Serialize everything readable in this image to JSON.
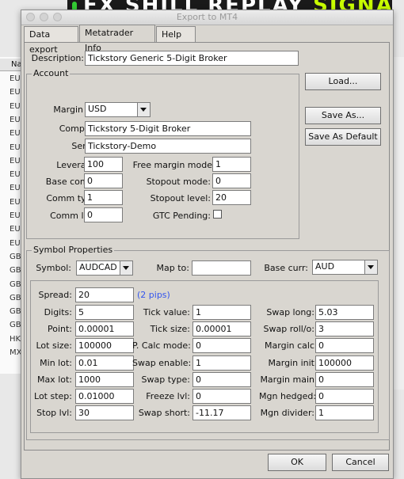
{
  "background": {
    "banner_text": "FX SHILL REPLAY ",
    "banner_highlight": "SIGNALS",
    "list_header": "Na",
    "list_rows": [
      "EU",
      "EU",
      "EU",
      "EU",
      "EU",
      "EU",
      "EU",
      "EU",
      "EU",
      "EU",
      "EU",
      "EU",
      "EU",
      "GB",
      "GB",
      "GB",
      "GB",
      "GB",
      "GB",
      "HK",
      "MX"
    ]
  },
  "window": {
    "title": "Export to MT4"
  },
  "tabs": [
    "Data export",
    "Metatrader Info",
    "Help"
  ],
  "description": {
    "label": "Description:",
    "value": "Tickstory Generic 5-Digit Broker"
  },
  "account": {
    "title": "Account",
    "margin_ccy": {
      "label": "Margin ccy:",
      "value": "USD"
    },
    "company": {
      "label": "Company:",
      "value": "Tickstory 5-Digit Broker"
    },
    "server": {
      "label": "Server:",
      "value": "Tickstory-Demo"
    },
    "leverage": {
      "label": "Leverage:",
      "value": "100"
    },
    "base_comm": {
      "label": "Base comm:",
      "value": "0"
    },
    "comm_type": {
      "label": "Comm type:",
      "value": "1"
    },
    "comm_lots": {
      "label": "Comm lots:",
      "value": "0"
    },
    "free_margin_mode": {
      "label": "Free margin mode",
      "value": "1"
    },
    "stopout_mode": {
      "label": "Stopout mode:",
      "value": "0"
    },
    "stopout_level": {
      "label": "Stopout level:",
      "value": "20"
    },
    "gtc_pending": {
      "label": "GTC Pending:",
      "checked": false
    }
  },
  "buttons": {
    "load": "Load...",
    "save_as": "Save As...",
    "save_default": "Save As Default",
    "ok": "OK",
    "cancel": "Cancel"
  },
  "symbol": {
    "title": "Symbol Properties",
    "symbol": {
      "label": "Symbol:",
      "value": "AUDCAD"
    },
    "map_to": {
      "label": "Map to:",
      "value": ""
    },
    "base_curr": {
      "label": "Base curr:",
      "value": "AUD"
    },
    "spread": {
      "label": "Spread:",
      "value": "20",
      "note": "(2 pips)"
    },
    "col1": [
      {
        "label": "Digits:",
        "value": "5"
      },
      {
        "label": "Point:",
        "value": "0.00001"
      },
      {
        "label": "Lot size:",
        "value": "100000"
      },
      {
        "label": "Min lot:",
        "value": "0.01"
      },
      {
        "label": "Max lot:",
        "value": "1000"
      },
      {
        "label": "Lot step:",
        "value": "0.01000"
      },
      {
        "label": "Stop lvl:",
        "value": "30"
      }
    ],
    "col2": [
      {
        "label": "Tick value:",
        "value": "1"
      },
      {
        "label": "Tick size:",
        "value": "0.00001"
      },
      {
        "label": "P. Calc mode:",
        "value": "0"
      },
      {
        "label": "Swap enable:",
        "value": "1"
      },
      {
        "label": "Swap type:",
        "value": "0"
      },
      {
        "label": "Freeze lvl:",
        "value": "0"
      },
      {
        "label": "Swap short:",
        "value": "-11.17"
      }
    ],
    "col3": [
      {
        "label": "Swap long:",
        "value": "5.03"
      },
      {
        "label": "Swap roll/o:",
        "value": "3"
      },
      {
        "label": "Margin calc",
        "value": "0"
      },
      {
        "label": "Margin init",
        "value": "100000"
      },
      {
        "label": "Margin main",
        "value": "0"
      },
      {
        "label": "Mgn hedged:",
        "value": "0"
      },
      {
        "label": "Mgn divider:",
        "value": "1"
      }
    ]
  }
}
